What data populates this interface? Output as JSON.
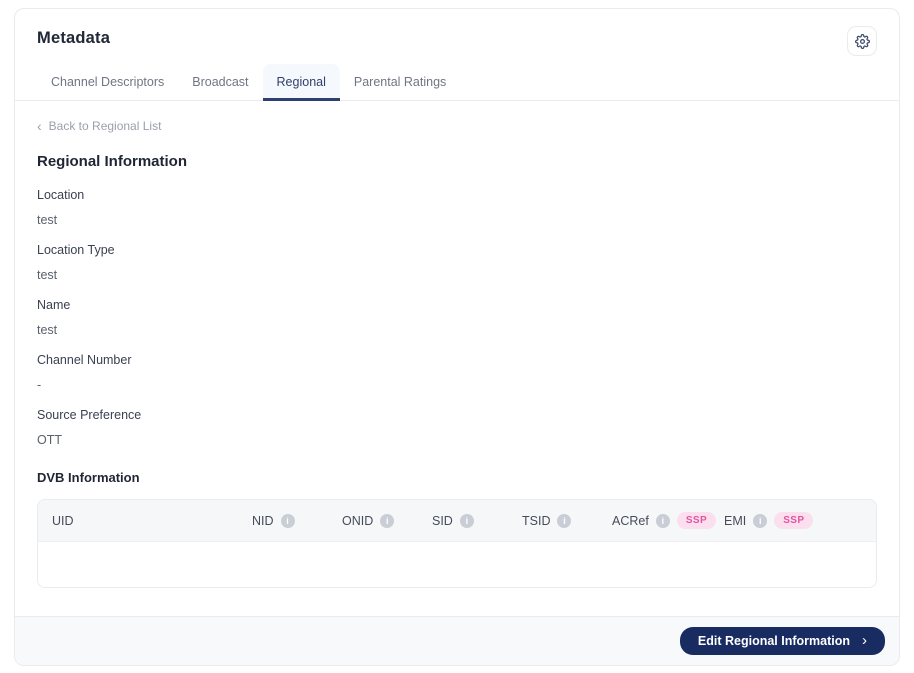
{
  "header": {
    "title": "Metadata"
  },
  "tabs": [
    {
      "label": "Channel Descriptors"
    },
    {
      "label": "Broadcast"
    },
    {
      "label": "Regional"
    },
    {
      "label": "Parental Ratings"
    }
  ],
  "active_tab": "Regional",
  "back_link": {
    "chevron": "‹",
    "label": "Back to Regional List"
  },
  "regional": {
    "title": "Regional Information",
    "fields": [
      {
        "label": "Location",
        "value": "test"
      },
      {
        "label": "Location Type",
        "value": "test"
      },
      {
        "label": "Name",
        "value": "test"
      },
      {
        "label": "Channel Number",
        "value": "-"
      },
      {
        "label": "Source Preference",
        "value": "OTT"
      }
    ]
  },
  "dvb": {
    "title": "DVB Information",
    "info_icon_glyph": "i",
    "columns": [
      {
        "label": "UID"
      },
      {
        "label": "NID",
        "info": true
      },
      {
        "label": "ONID",
        "info": true
      },
      {
        "label": "SID",
        "info": true
      },
      {
        "label": "TSID",
        "info": true
      },
      {
        "label": "ACRef",
        "info": true,
        "badge": "SSP"
      },
      {
        "label": "EMI",
        "info": true,
        "badge": "SSP"
      }
    ],
    "rows": []
  },
  "footer": {
    "edit_button_label": "Edit Regional Information",
    "chevron": "›"
  },
  "colors": {
    "accent_navy": "#182c62",
    "active_tab_underline": "#2e4070",
    "active_tab_bg": "#f5f8fc",
    "ssp_pink": "#e2569e",
    "ssp_pink_bg": "#fbdfee",
    "table_header_bg": "#f6f7f9",
    "footer_bg": "#f8f9fb"
  }
}
